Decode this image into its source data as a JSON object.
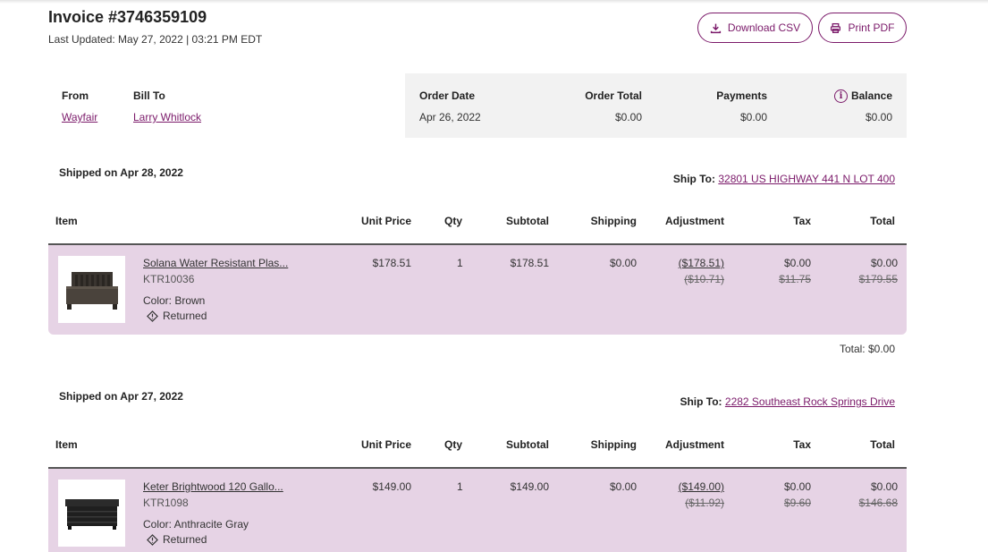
{
  "header": {
    "title": "Invoice #3746359109",
    "last_updated": "Last Updated: May 27, 2022 | 03:21 PM EDT",
    "download_csv": "Download CSV",
    "print_pdf": "Print PDF"
  },
  "summary": {
    "from_label": "From",
    "from_value": "Wayfair",
    "bill_to_label": "Bill To",
    "bill_to_value": "Larry Whitlock",
    "order_date_label": "Order Date",
    "order_date_value": "Apr 26, 2022",
    "order_total_label": "Order Total",
    "order_total_value": "$0.00",
    "payments_label": "Payments",
    "payments_value": "$0.00",
    "balance_label": "Balance",
    "balance_value": "$0.00"
  },
  "columns": {
    "item": "Item",
    "unit_price": "Unit Price",
    "qty": "Qty",
    "subtotal": "Subtotal",
    "shipping": "Shipping",
    "adjustment": "Adjustment",
    "tax": "Tax",
    "total": "Total"
  },
  "shipments": [
    {
      "shipped_on": "Shipped on Apr 28, 2022",
      "ship_to_label": "Ship To:",
      "ship_to_address": "32801 US HIGHWAY 441 N LOT 400",
      "item": {
        "name": "Solana Water Resistant Plas...",
        "sku": "KTR10036",
        "color": "Color: Brown",
        "status": "Returned",
        "unit_price": "$178.51",
        "qty": "1",
        "subtotal": "$178.51",
        "shipping": "$0.00",
        "adjustment": "($178.51)",
        "adjustment_orig": "($10.71)",
        "tax": "$0.00",
        "tax_orig": "$11.75",
        "total": "$0.00",
        "total_orig": "$179.55"
      },
      "shipment_total": "Total: $0.00"
    },
    {
      "shipped_on": "Shipped on Apr 27, 2022",
      "ship_to_label": "Ship To:",
      "ship_to_address": "2282 Southeast Rock Springs Drive",
      "item": {
        "name": "Keter Brightwood 120 Gallo...",
        "sku": "KTR1098",
        "color": "Color: Anthracite Gray",
        "status": "Returned",
        "unit_price": "$149.00",
        "qty": "1",
        "subtotal": "$149.00",
        "shipping": "$0.00",
        "adjustment": "($149.00)",
        "adjustment_orig": "($11.92)",
        "tax": "$0.00",
        "tax_orig": "$9.60",
        "total": "$0.00",
        "total_orig": "$146.68"
      }
    }
  ],
  "colors": {
    "accent": "#7b1a6a",
    "row_highlight": "#e6d3e5",
    "summary_bg": "#f2f2f2"
  }
}
